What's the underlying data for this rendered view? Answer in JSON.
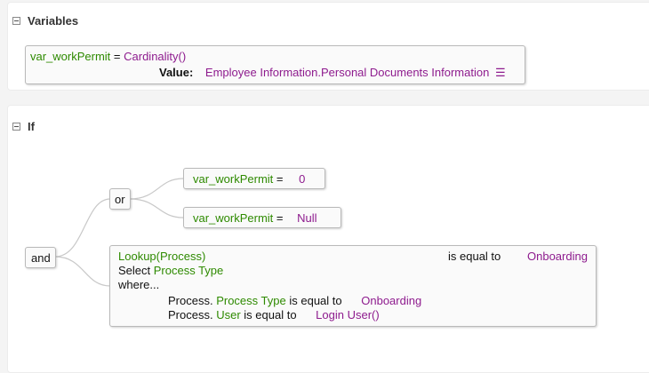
{
  "variables": {
    "title": "Variables",
    "expr_var": "var_workPermit",
    "expr_eq": " = ",
    "expr_func": "Cardinality()",
    "value_label": "Value:",
    "value_text": "Employee Information.Personal Documents Information",
    "list_icon_glyph": "☰"
  },
  "if_section": {
    "title": "If",
    "and_label": "and",
    "or_label": "or",
    "cond1": {
      "var": "var_workPermit",
      "op": " = ",
      "value": "0"
    },
    "cond2": {
      "var": "var_workPermit",
      "op": " = ",
      "value": "Null"
    },
    "lookup": {
      "func": "Lookup(Process)",
      "compare": "is equal to",
      "compare_value": "Onboarding",
      "select_word": "Select ",
      "select_field": "Process Type",
      "where": "where...",
      "w1_obj": "Process.",
      "w1_field": "Process Type",
      "w1_op": "is equal to",
      "w1_val": "Onboarding",
      "w2_obj": "Process.",
      "w2_field": "User",
      "w2_op": "is equal to",
      "w2_val": "Login User()"
    }
  },
  "colors": {
    "field": "#2e8a00",
    "value": "#8e1b8e",
    "border": "#b9b9b9"
  }
}
